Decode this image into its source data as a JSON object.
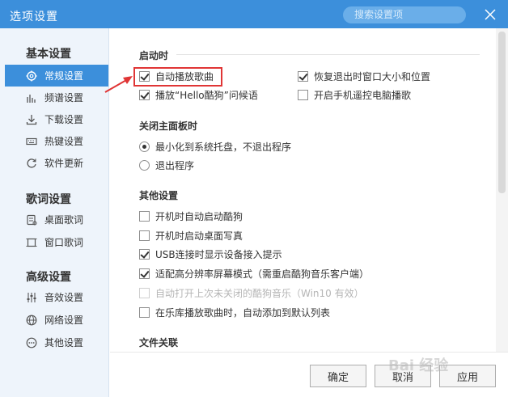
{
  "window": {
    "title": "选项设置",
    "search_placeholder": "搜索设置项"
  },
  "sidebar": {
    "groups": [
      {
        "title": "基本设置",
        "items": [
          {
            "label": "常规设置",
            "icon": "gear-icon",
            "active": true
          },
          {
            "label": "频谱设置",
            "icon": "spectrum-icon"
          },
          {
            "label": "下载设置",
            "icon": "download-icon"
          },
          {
            "label": "热键设置",
            "icon": "keyboard-icon"
          },
          {
            "label": "软件更新",
            "icon": "update-icon"
          }
        ]
      },
      {
        "title": "歌词设置",
        "items": [
          {
            "label": "桌面歌词",
            "icon": "desktop-lyrics-icon"
          },
          {
            "label": "窗口歌词",
            "icon": "window-lyrics-icon"
          }
        ]
      },
      {
        "title": "高级设置",
        "items": [
          {
            "label": "音效设置",
            "icon": "equalizer-icon"
          },
          {
            "label": "网络设置",
            "icon": "network-icon"
          },
          {
            "label": "其他设置",
            "icon": "more-icon"
          }
        ]
      }
    ]
  },
  "content": {
    "startup": {
      "title": "启动时",
      "options": [
        {
          "label": "自动播放歌曲",
          "checked": true
        },
        {
          "label": "恢复退出时窗口大小和位置",
          "checked": true
        },
        {
          "label": "播放“Hello酷狗”问候语",
          "checked": true
        },
        {
          "label": "开启手机遥控电脑播歌",
          "checked": false
        }
      ]
    },
    "close_panel": {
      "title": "关闭主面板时",
      "options": [
        {
          "label": "最小化到系统托盘，不退出程序",
          "selected": true
        },
        {
          "label": "退出程序",
          "selected": false
        }
      ]
    },
    "other": {
      "title": "其他设置",
      "options": [
        {
          "label": "开机时自动启动酷狗",
          "checked": false,
          "disabled": false
        },
        {
          "label": "开机时启动桌面写真",
          "checked": false,
          "disabled": false
        },
        {
          "label": "USB连接时显示设备接入提示",
          "checked": true,
          "disabled": false
        },
        {
          "label": "适配高分辨率屏幕模式（需重启酷狗音乐客户端）",
          "checked": true,
          "disabled": false
        },
        {
          "label": "自动打开上次未关闭的酷狗音乐（Win10 有效）",
          "checked": false,
          "disabled": true
        },
        {
          "label": "在乐库播放歌曲时，自动添加到默认列表",
          "checked": false,
          "disabled": false
        }
      ]
    },
    "file_assoc": {
      "title": "文件关联"
    }
  },
  "buttons": {
    "ok": "确定",
    "cancel": "取消",
    "apply": "应用"
  },
  "colors": {
    "accent": "#3c8fdb",
    "highlight_border": "#e03535"
  },
  "watermark": "Bai 经验"
}
